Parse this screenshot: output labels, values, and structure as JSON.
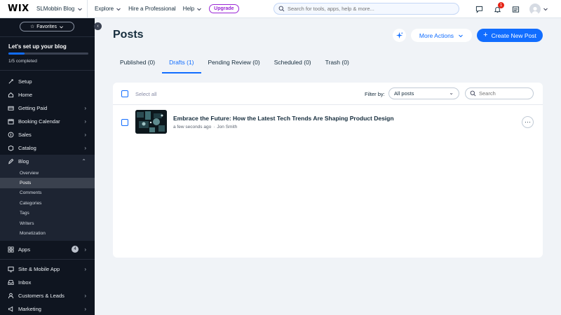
{
  "topbar": {
    "logo": "WIX",
    "site_name": "SLMobbin Blog",
    "nav": [
      {
        "label": "Explore",
        "has_menu": true
      },
      {
        "label": "Hire a Professional",
        "has_menu": false
      },
      {
        "label": "Help",
        "has_menu": true
      }
    ],
    "upgrade_label": "Upgrade",
    "search_placeholder": "Search for tools, apps, help & more...",
    "notifications_count": "1"
  },
  "sidebar": {
    "favorites_label": "Favorites",
    "setup_title": "Let's set up your blog",
    "setup_progress": 0.2,
    "setup_count": "1/5 completed",
    "items": [
      {
        "label": "Setup",
        "icon": "setup-icon",
        "arrow": false
      },
      {
        "label": "Home",
        "icon": "home-icon",
        "arrow": false
      },
      {
        "label": "Getting Paid",
        "icon": "getting-paid-icon",
        "arrow": true
      },
      {
        "label": "Booking Calendar",
        "icon": "calendar-icon",
        "arrow": true
      },
      {
        "label": "Sales",
        "icon": "sales-icon",
        "arrow": true
      },
      {
        "label": "Catalog",
        "icon": "catalog-icon",
        "arrow": true
      },
      {
        "label": "Blog",
        "icon": "blog-icon",
        "arrow": true
      }
    ],
    "blog_sub": [
      "Overview",
      "Posts",
      "Comments",
      "Categories",
      "Tags",
      "Writers",
      "Monetization"
    ],
    "blog_active": "Posts",
    "apps": {
      "label": "Apps",
      "count": "4"
    },
    "items_bottom": [
      {
        "label": "Site & Mobile App",
        "icon": "site-icon",
        "arrow": true
      },
      {
        "label": "Inbox",
        "icon": "inbox-icon",
        "arrow": false
      },
      {
        "label": "Customers & Leads",
        "icon": "customers-icon",
        "arrow": true
      },
      {
        "label": "Marketing",
        "icon": "marketing-icon",
        "arrow": true
      }
    ]
  },
  "main": {
    "title": "Posts",
    "more_actions_label": "More Actions",
    "create_label": "Create New Post",
    "tabs": [
      {
        "label": "Published (0)",
        "active": false
      },
      {
        "label": "Drafts (1)",
        "active": true
      },
      {
        "label": "Pending Review (0)",
        "active": false
      },
      {
        "label": "Scheduled (0)",
        "active": false
      },
      {
        "label": "Trash (0)",
        "active": false
      }
    ],
    "select_all_label": "Select all",
    "filter_label": "Filter by:",
    "filter_value": "All posts",
    "search_placeholder": "Search",
    "posts": [
      {
        "title": "Embrace the Future: How the Latest Tech Trends Are Shaping Product Design",
        "time": "a few seconds ago",
        "author": "Jon Smith"
      }
    ]
  },
  "colors": {
    "accent": "#116dff",
    "sidebar_bg": "#0f1520",
    "page_bg": "#f0f3f7",
    "upgrade": "#9a27d5"
  }
}
